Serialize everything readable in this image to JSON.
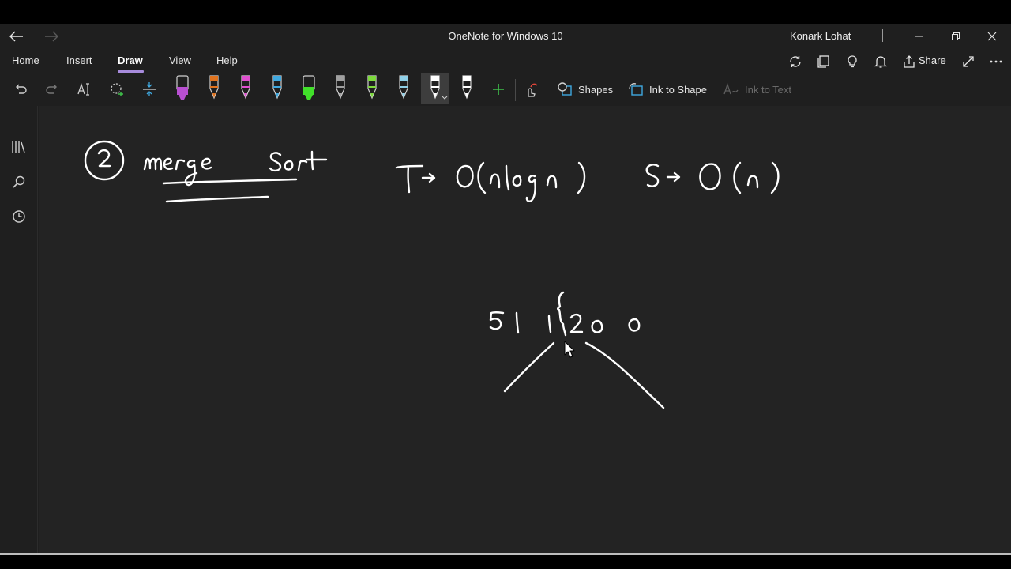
{
  "window": {
    "title": "OneNote for Windows 10",
    "user": "Konark Lohat"
  },
  "ribbon": {
    "tabs": [
      {
        "label": "Home"
      },
      {
        "label": "Insert"
      },
      {
        "label": "Draw",
        "active": true
      },
      {
        "label": "View"
      },
      {
        "label": "Help"
      }
    ],
    "share_label": "Share"
  },
  "toolbar": {
    "shapes_label": "Shapes",
    "ink_to_shape_label": "Ink to Shape",
    "ink_to_text_label": "Ink to Text",
    "pens": [
      {
        "icon": "highlighter-icon",
        "color": "#b84fd1"
      },
      {
        "icon": "pen-icon",
        "color": "#e0731e"
      },
      {
        "icon": "pen-icon",
        "color": "#e04fd0"
      },
      {
        "icon": "pen-icon",
        "color": "#3fa9e0"
      },
      {
        "icon": "highlighter-icon",
        "color": "#41e02a"
      },
      {
        "icon": "pen-icon",
        "color": "#a0a0a0"
      },
      {
        "icon": "pen-icon",
        "color": "#7cd93b"
      },
      {
        "icon": "pen-icon",
        "color": "#8fd0e8"
      },
      {
        "icon": "pen-icon",
        "color": "#ffffff",
        "selected": true
      },
      {
        "icon": "pen-icon",
        "color": "#ffffff"
      }
    ],
    "add_pen_color": "#3fc04a"
  },
  "handwriting": {
    "heading": "2 merge sort",
    "time_complexity": "T → O(n log n)",
    "space_complexity": "S → O(n)",
    "array": "5 1 1 2 0 0"
  },
  "colors": {
    "ink": "#ffffff",
    "accent": "#a78bdc",
    "canvas": "#232323"
  }
}
